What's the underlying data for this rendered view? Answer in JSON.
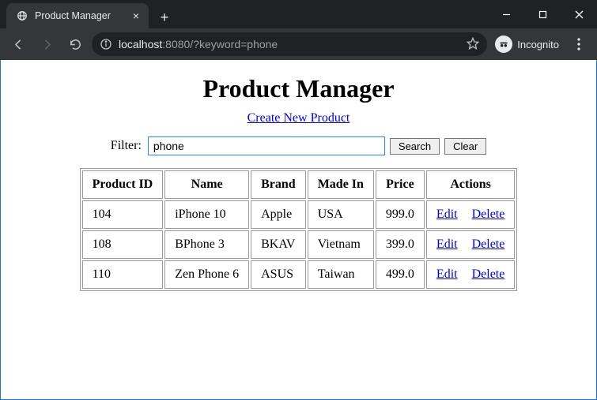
{
  "browser": {
    "tab_title": "Product Manager",
    "url_host": "localhost",
    "url_port_path": ":8080/?keyword=phone",
    "incognito_label": "Incognito"
  },
  "page": {
    "heading": "Product Manager",
    "create_link": "Create New Product",
    "filter_label": "Filter:",
    "filter_value": "phone",
    "search_button": "Search",
    "clear_button": "Clear",
    "columns": {
      "id": "Product ID",
      "name": "Name",
      "brand": "Brand",
      "made_in": "Made In",
      "price": "Price",
      "actions": "Actions"
    },
    "action_labels": {
      "edit": "Edit",
      "delete": "Delete"
    },
    "rows": [
      {
        "id": "104",
        "name": "iPhone 10",
        "brand": "Apple",
        "made_in": "USA",
        "price": "999.0"
      },
      {
        "id": "108",
        "name": "BPhone 3",
        "brand": "BKAV",
        "made_in": "Vietnam",
        "price": "399.0"
      },
      {
        "id": "110",
        "name": "Zen Phone 6",
        "brand": "ASUS",
        "made_in": "Taiwan",
        "price": "499.0"
      }
    ]
  }
}
